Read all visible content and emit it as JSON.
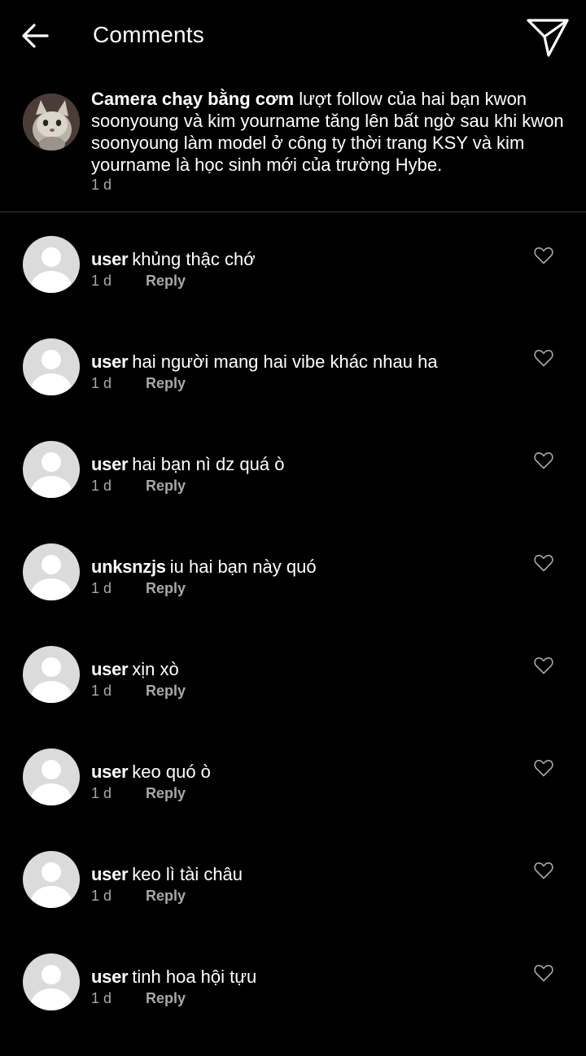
{
  "header": {
    "title": "Comments",
    "back_icon": "back-arrow-icon",
    "send_icon": "paper-plane-icon"
  },
  "post": {
    "username": "Camera chạy bằng cơm",
    "text": "lượt follow của hai bạn kwon soonyoung và kim yourname tăng lên bất ngờ sau khi kwon soonyoung làm model ở công ty thời trang KSY và kim yourname là học sinh mới của trường Hybe.",
    "time": "1 d"
  },
  "comments": [
    {
      "username": "user",
      "text": "khủng thậc chớ",
      "time": "1 d",
      "reply_label": "Reply"
    },
    {
      "username": "user",
      "text": "hai người mang hai vibe khác nhau ha",
      "time": "1 d",
      "reply_label": "Reply"
    },
    {
      "username": "user",
      "text": "hai bạn nì dz quá ò",
      "time": "1 d",
      "reply_label": "Reply"
    },
    {
      "username": "unksnzjs",
      "text": "iu hai bạn này quó",
      "time": "1 d",
      "reply_label": "Reply"
    },
    {
      "username": "user",
      "text": "xịn xò",
      "time": "1 d",
      "reply_label": "Reply"
    },
    {
      "username": "user",
      "text": "keo quó ò",
      "time": "1 d",
      "reply_label": "Reply"
    },
    {
      "username": "user",
      "text": "keo lì tài châu",
      "time": "1 d",
      "reply_label": "Reply"
    },
    {
      "username": "user",
      "text": "tinh hoa hội tựu",
      "time": "1 d",
      "reply_label": "Reply"
    }
  ],
  "colors": {
    "background": "#000000",
    "text": "#ffffff",
    "muted": "#a8a8a8",
    "avatar_placeholder": "#dbdbdb",
    "divider": "#3a3a3a"
  }
}
